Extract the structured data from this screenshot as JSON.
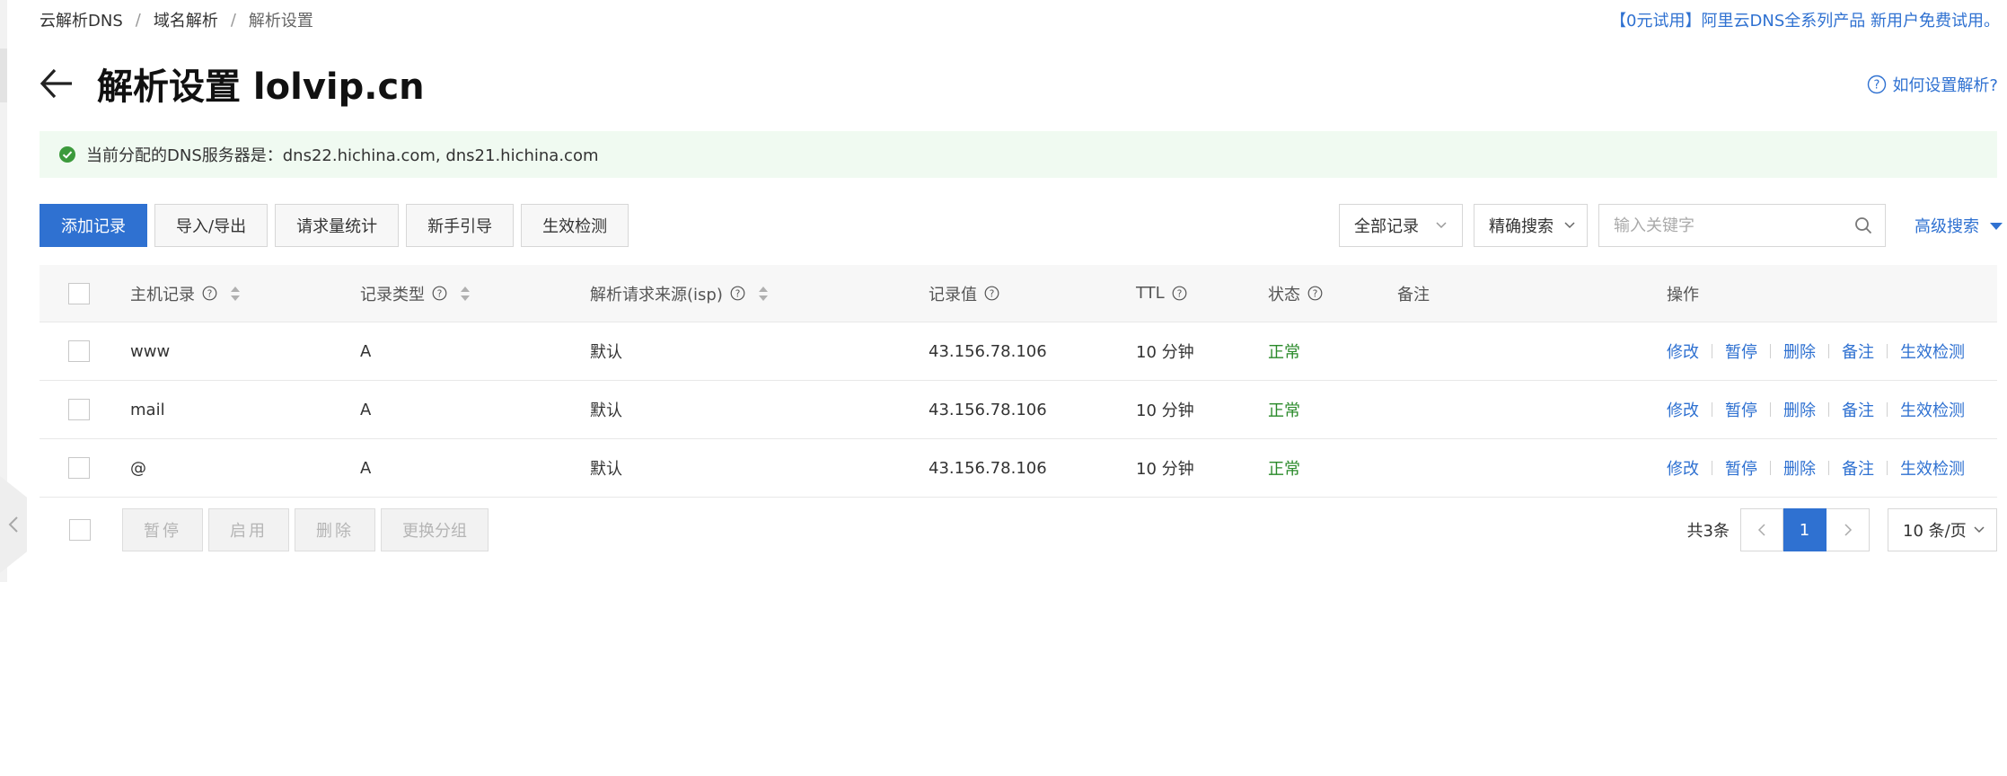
{
  "breadcrumb": {
    "items": [
      "云解析DNS",
      "域名解析",
      "解析设置"
    ],
    "separator": "/"
  },
  "promo": "【0元试用】阿里云DNS全系列产品 新用户免费试用。",
  "title": "解析设置 lolvip.cn",
  "help_link": "如何设置解析?",
  "dns_info": "当前分配的DNS服务器是：dns22.hichina.com, dns21.hichina.com",
  "toolbar": {
    "buttons": [
      "添加记录",
      "导入/导出",
      "请求量统计",
      "新手引导",
      "生效检测"
    ]
  },
  "filters": {
    "record_filter": "全部记录",
    "search_mode": "精确搜索",
    "keyword_placeholder": "输入关键字",
    "advanced_search": "高级搜索"
  },
  "table": {
    "columns": [
      "主机记录",
      "记录类型",
      "解析请求来源(isp)",
      "记录值",
      "TTL",
      "状态",
      "备注",
      "操作"
    ],
    "actions": [
      "修改",
      "暂停",
      "删除",
      "备注",
      "生效检测"
    ],
    "rows": [
      {
        "host": "www",
        "type": "A",
        "isp": "默认",
        "value": "43.156.78.106",
        "ttl": "10 分钟",
        "status": "正常",
        "remark": ""
      },
      {
        "host": "mail",
        "type": "A",
        "isp": "默认",
        "value": "43.156.78.106",
        "ttl": "10 分钟",
        "status": "正常",
        "remark": ""
      },
      {
        "host": "@",
        "type": "A",
        "isp": "默认",
        "value": "43.156.78.106",
        "ttl": "10 分钟",
        "status": "正常",
        "remark": ""
      }
    ]
  },
  "bulk_actions": [
    "暂停",
    "启用",
    "删除",
    "更换分组"
  ],
  "pagination": {
    "total": "共3条",
    "current_page": "1",
    "page_size": "10 条/页"
  },
  "colors": {
    "primary": "#2f71d1",
    "success": "#2a8a2a",
    "info_bg": "#f0faf1"
  }
}
